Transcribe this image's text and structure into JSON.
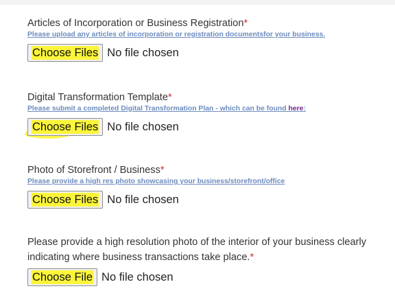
{
  "form": {
    "fields": [
      {
        "label": "Articles of Incorporation or Business Registration",
        "required_mark": "*",
        "help": "Please upload any articles of incorporation or registration documentsfor your business.",
        "button_label": "Choose Files",
        "status": "No file chosen"
      },
      {
        "label": "Digital Transformation Template",
        "required_mark": "*",
        "help": "Please submit a completed Digital Transformation Plan - which can be found ",
        "help_link": "here",
        "help_suffix": ":",
        "button_label": "Choose Files",
        "status": "No file chosen"
      },
      {
        "label": "Photo of Storefront / Business",
        "required_mark": "*",
        "help": "Please provide a high res photo showcasing your business/storefront/office",
        "button_label": "Choose Files",
        "status": "No file chosen"
      },
      {
        "label": "Please provide a high resolution photo of the interior of your business clearly indicating where business transactions take place.",
        "required_mark": "*",
        "button_label": "Choose File",
        "status": "No file chosen"
      }
    ]
  },
  "colors": {
    "highlight": "#fbf53a",
    "required": "#e0262b",
    "help_link": "#6d8cbf",
    "visited_link": "#6b2a8c"
  }
}
